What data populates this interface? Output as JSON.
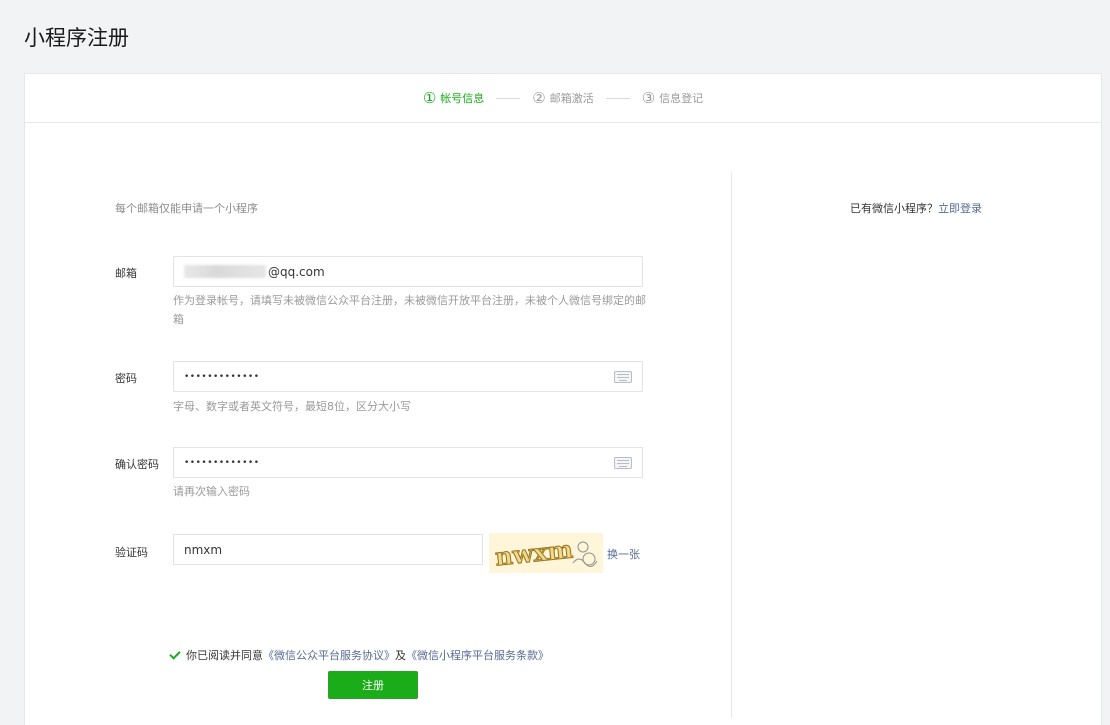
{
  "page": {
    "title": "小程序注册"
  },
  "steps": [
    {
      "num": "①",
      "label": "帐号信息"
    },
    {
      "num": "②",
      "label": "邮箱激活"
    },
    {
      "num": "③",
      "label": "信息登记"
    }
  ],
  "form": {
    "intro": "每个邮箱仅能申请一个小程序",
    "email": {
      "label": "邮箱",
      "value": "@qq.com",
      "hint": "作为登录帐号，请填写未被微信公众平台注册，未被微信开放平台注册，未被个人微信号绑定的邮箱"
    },
    "password": {
      "label": "密码",
      "value": "•••••••••••••",
      "hint": "字母、数字或者英文符号，最短8位，区分大小写"
    },
    "confirm": {
      "label": "确认密码",
      "value": "•••••••••••••",
      "hint": "请再次输入密码"
    },
    "captcha": {
      "label": "验证码",
      "value": "nmxm",
      "swap": "换一张",
      "image_text": "nwxm"
    },
    "agreement": {
      "prefix": "你已阅读并同意",
      "link1": "《微信公众平台服务协议》",
      "and": "及",
      "link2": "《微信小程序平台服务条款》"
    },
    "submit": "注册"
  },
  "sidebar": {
    "text": "已有微信小程序？",
    "link": "立即登录"
  },
  "colors": {
    "accent": "#1aad19",
    "link": "#576b95",
    "background": "#f2f3f5"
  }
}
